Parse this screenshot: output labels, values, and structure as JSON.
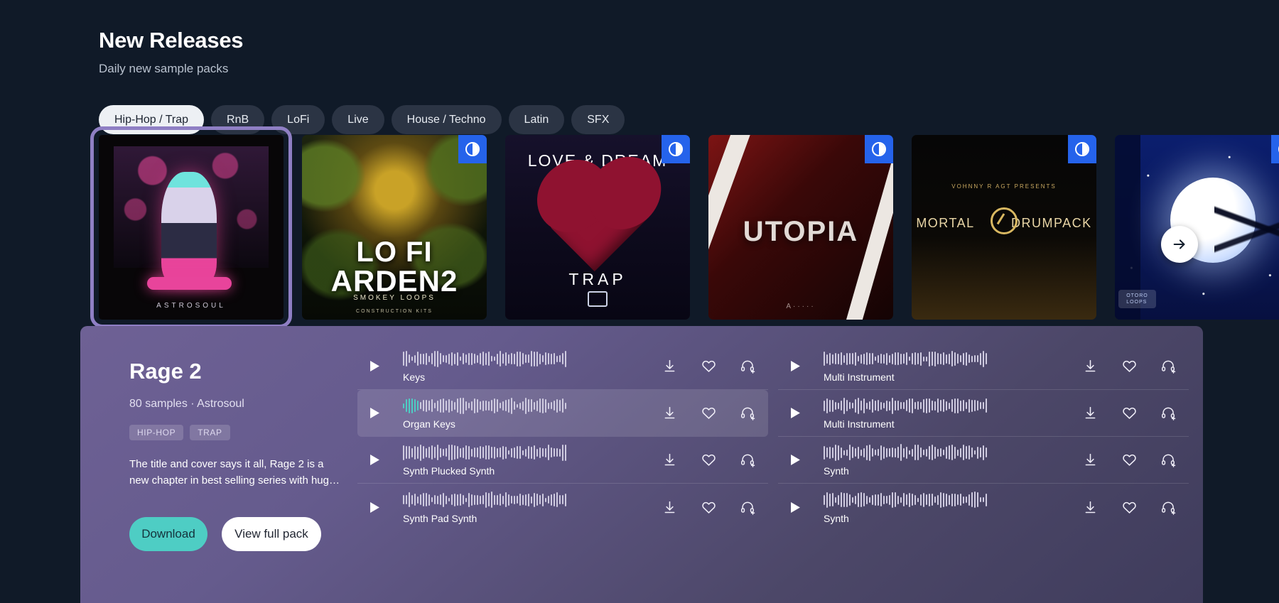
{
  "header": {
    "title": "New Releases",
    "subtitle": "Daily new sample packs"
  },
  "filters": [
    {
      "label": "Hip-Hop / Trap",
      "active": true
    },
    {
      "label": "RnB",
      "active": false
    },
    {
      "label": "LoFi",
      "active": false
    },
    {
      "label": "Live",
      "active": false
    },
    {
      "label": "House / Techno",
      "active": false
    },
    {
      "label": "Latin",
      "active": false
    },
    {
      "label": "SFX",
      "active": false
    }
  ],
  "carousel": {
    "next_label": "Next",
    "items": [
      {
        "name": "Rage 2",
        "artist_mark": "ASTROSOUL",
        "selected": true,
        "badge": false
      },
      {
        "name": "LO FI ARDEN2",
        "line1": "LO FI",
        "line2": "ARDEN2",
        "line3": "SMOKEY LOOPS",
        "line4": "CONSTRUCTION KITS",
        "selected": false,
        "badge": true
      },
      {
        "name": "Love & Dream Trap",
        "top": "LOVE & DREAM",
        "bottom": "TRAP",
        "selected": false,
        "badge": true
      },
      {
        "name": "Utopia",
        "title": "UTOPIA",
        "sig": "A·····",
        "selected": false,
        "badge": true
      },
      {
        "name": "Mortal Drumpack",
        "presents": "VOHNNY R AGT PRESENTS",
        "title_left": "MORTAL",
        "title_right": "DRUMPACK",
        "selected": false,
        "badge": true
      },
      {
        "name": "Moonlight",
        "tag": "OTORO\nLOOPS",
        "selected": false,
        "badge": true
      }
    ]
  },
  "detail": {
    "title": "Rage 2",
    "meta": "80 samples · Astrosoul",
    "tags": [
      "HIP-HOP",
      "TRAP"
    ],
    "description": "The title and cover says it all, Rage 2 is a new chapter in best selling series with hug…",
    "download_label": "Download",
    "view_label": "View full pack",
    "row_icons": {
      "download": "download-icon",
      "favorite": "heart-icon",
      "add_to_playlist": "headphones-add-icon",
      "play": "play-icon"
    },
    "columns": [
      {
        "rows": [
          {
            "label": "Keys",
            "active": false,
            "progress": 0,
            "seed": 11
          },
          {
            "label": "Organ  Keys",
            "active": true,
            "progress": 6,
            "seed": 23
          },
          {
            "label": "Synth Plucked  Synth",
            "active": false,
            "progress": 0,
            "seed": 37
          },
          {
            "label": "Synth Pad  Synth",
            "active": false,
            "progress": 0,
            "seed": 53
          }
        ]
      },
      {
        "rows": [
          {
            "label": "Multi Instrument",
            "active": false,
            "progress": 0,
            "seed": 67
          },
          {
            "label": "Multi Instrument",
            "active": false,
            "progress": 0,
            "seed": 79
          },
          {
            "label": "Synth",
            "active": false,
            "progress": 0,
            "seed": 91
          },
          {
            "label": "Synth",
            "active": false,
            "progress": 0,
            "seed": 103
          }
        ]
      }
    ]
  },
  "colors": {
    "background": "#101a28",
    "chip_active_bg": "#edf0f4",
    "chip_bg": "#2b3444",
    "panel_gradient_start": "#6e6195",
    "panel_gradient_end": "#3f3c5c",
    "accent_teal": "#4ecdc4",
    "badge_blue": "#2563eb",
    "selection_border": "#8f7fc4"
  }
}
